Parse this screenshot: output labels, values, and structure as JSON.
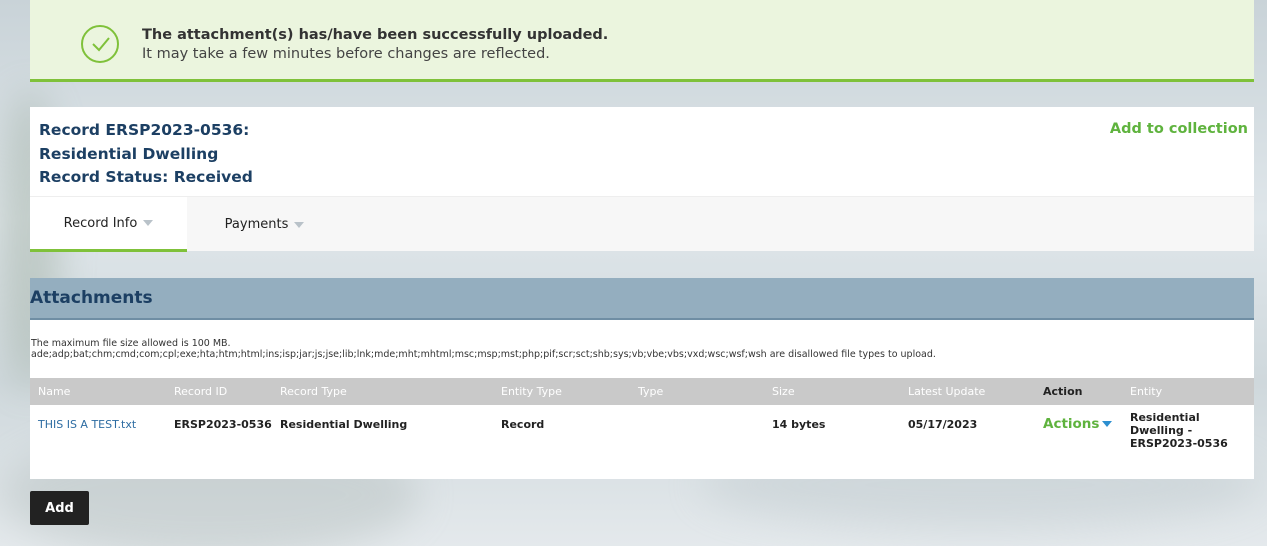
{
  "banner": {
    "title": "The attachment(s) has/have been successfully uploaded.",
    "message": "It may take a few minutes before changes are reflected.",
    "icon": "check-circle-icon",
    "accent_color": "#7fc13a"
  },
  "record": {
    "id_line": "Record ERSP2023-0536:",
    "type_line": "Residential Dwelling",
    "status_line": "Record Status: Received",
    "add_to_collection": "Add to collection"
  },
  "tabs": [
    {
      "label": "Record Info",
      "active": true
    },
    {
      "label": "Payments",
      "active": false
    }
  ],
  "attachments": {
    "title": "Attachments",
    "max_size_note": "The maximum file size allowed is 100 MB.",
    "disallowed_note": "ade;adp;bat;chm;cmd;com;cpl;exe;hta;htm;html;ins;isp;jar;js;jse;lib;lnk;mde;mht;mhtml;msc;msp;mst;php;pif;scr;sct;shb;sys;vb;vbe;vbs;vxd;wsc;wsf;wsh are disallowed file types to upload.",
    "columns": [
      "Name",
      "Record ID",
      "Record Type",
      "Entity Type",
      "Type",
      "Size",
      "Latest Update",
      "Action",
      "Entity"
    ],
    "rows": [
      {
        "name": "THIS IS A TEST.txt",
        "record_id": "ERSP2023-0536",
        "record_type": "Residential Dwelling",
        "entity_type": "Record",
        "type": "",
        "size": "14 bytes",
        "latest_update": "05/17/2023",
        "action": "Actions",
        "entity_line1": "Residential Dwelling -",
        "entity_line2": "ERSP2023-0536"
      }
    ],
    "add_label": "Add"
  },
  "colors": {
    "brand_green": "#5fb33e",
    "header_blue": "#1c3f63",
    "section_bar": "#94aebf",
    "link_blue": "#2d6ca2"
  }
}
